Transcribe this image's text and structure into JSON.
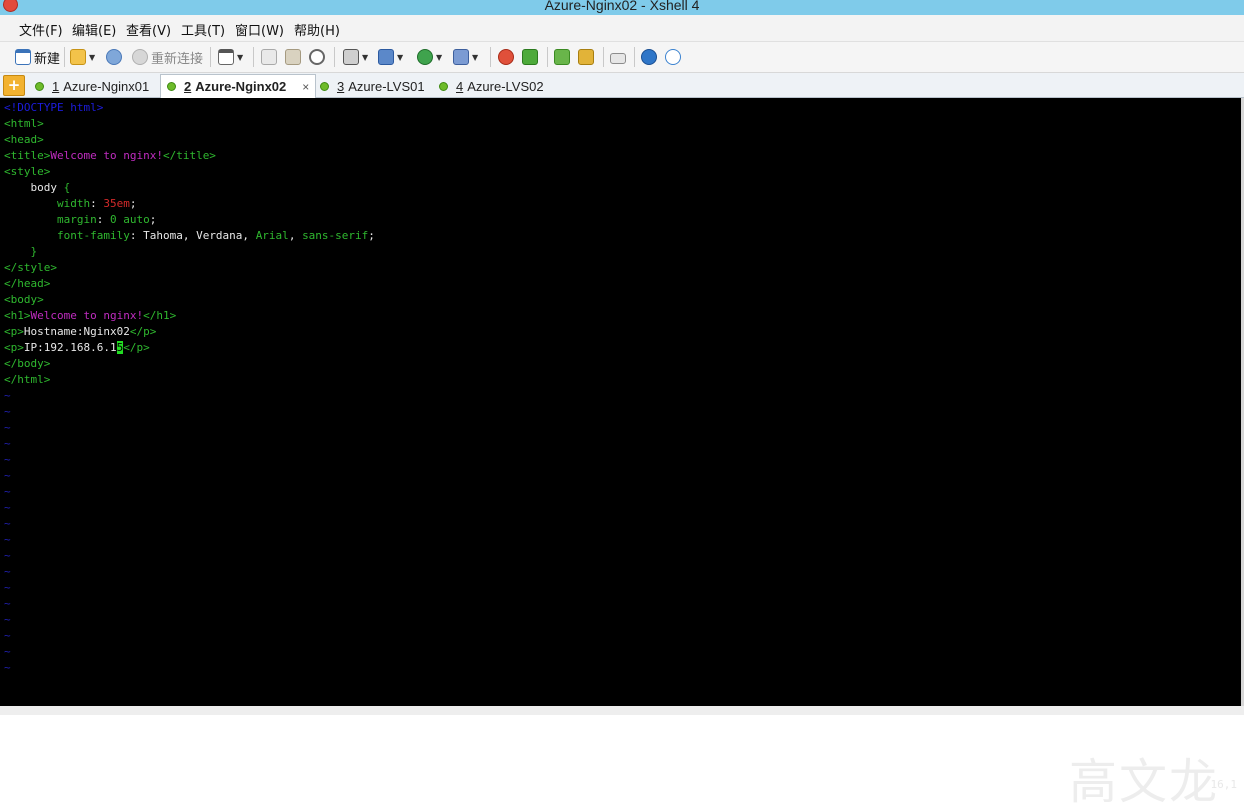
{
  "window": {
    "title": "Azure-Nginx02 - Xshell 4"
  },
  "menu": [
    "文件(F)",
    "编辑(E)",
    "查看(V)",
    "工具(T)",
    "窗口(W)",
    "帮助(H)"
  ],
  "toolbar": {
    "new_label": "新建",
    "reconnect_label": "重新连接"
  },
  "tabs": [
    {
      "num": "1",
      "label": "Azure-Nginx01",
      "active": false
    },
    {
      "num": "2",
      "label": "Azure-Nginx02",
      "active": true,
      "close": "×"
    },
    {
      "num": "3",
      "label": "Azure-LVS01",
      "active": false
    },
    {
      "num": "4",
      "label": "Azure-LVS02",
      "active": false
    }
  ],
  "terminal": {
    "lines": {
      "l0": "<!DOCTYPE html>",
      "l1": "<html>",
      "l2": "<head>",
      "l3a": "<title>",
      "l3b": "Welcome to nginx!",
      "l3c": "</title>",
      "l4": "<style>",
      "l5a": "    body ",
      "l5b": "{",
      "l6a": "        width",
      "l6b": ": ",
      "l6c": "35em",
      "l6d": ";",
      "l7a": "        margin",
      "l7b": ": ",
      "l7c": "0 auto",
      "l7d": ";",
      "l8a": "        font-family",
      "l8b": ": Tahoma, Verdana, ",
      "l8c": "Arial",
      "l8d": ", ",
      "l8e": "sans-serif",
      "l8f": ";",
      "l9": "    }",
      "l10": "</style>",
      "l11": "</head>",
      "l12": "<body>",
      "l13a": "<h1>",
      "l13b": "Welcome to nginx!",
      "l13c": "</h1>",
      "l14a": "<p>",
      "l14b": "Hostname:Nginx02",
      "l14c": "</p>",
      "l15a": "<p>",
      "l15b": "IP:192.168.6.1",
      "l15c": "5",
      "l15d": "</p>",
      "l16": "</body>",
      "l17": "</html>"
    },
    "tilde": "~",
    "cursor_position": "16,1"
  },
  "watermark": "高文龙",
  "colors": {
    "titlebar": "#7fcbea",
    "terminal_bg": "#000000",
    "tag_green": "#2fb82f",
    "string_magenta": "#c02cc0",
    "value_red": "#d42a2a",
    "doctype_blue": "#1c1cdc",
    "cursor_green": "#22dd22"
  },
  "icons": {
    "app": "xshell-logo-icon",
    "new": "new-session-icon",
    "open": "folder-open-icon",
    "disconnect": "link-icon",
    "reconnect": "reconnect-icon",
    "properties": "properties-icon",
    "copy": "copy-icon",
    "paste": "paste-icon",
    "find": "find-icon",
    "print": "print-icon",
    "transfer": "transfer-icon",
    "globe": "globe-icon",
    "font": "font-icon",
    "xftp": "xftp-icon",
    "tunnel": "tunnel-icon",
    "layout": "layout-icon",
    "lock": "lock-icon",
    "keyboard": "keyboard-icon",
    "help": "help-icon",
    "chat": "chat-icon"
  }
}
